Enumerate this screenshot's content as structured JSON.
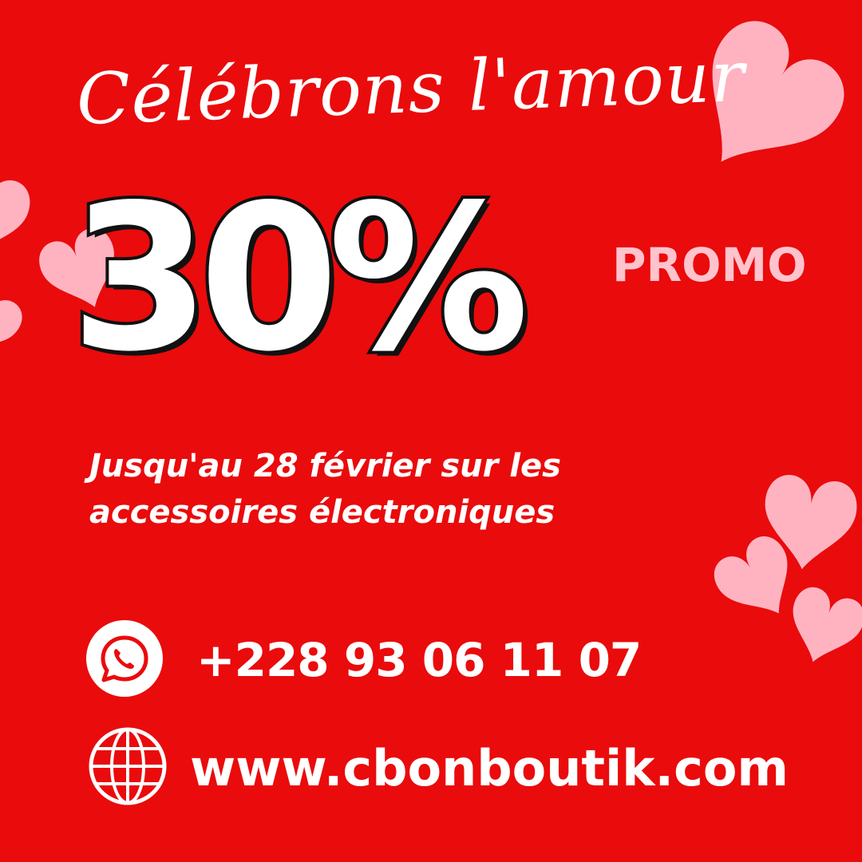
{
  "poster": {
    "background_color": "#ea0b0c",
    "heart_color": "#ffb3c1",
    "headline": "Célébrons l'amour",
    "discount": "30%",
    "promo": "PROMO",
    "details": {
      "line1": "Jusqu'au 28 février sur les",
      "line2": "accessoires électroniques"
    },
    "contact": {
      "icon": "whatsapp-icon",
      "phone": "+228 93 06 11 07"
    },
    "website": {
      "icon": "globe-icon",
      "url": "www.cbonboutik.com"
    }
  }
}
